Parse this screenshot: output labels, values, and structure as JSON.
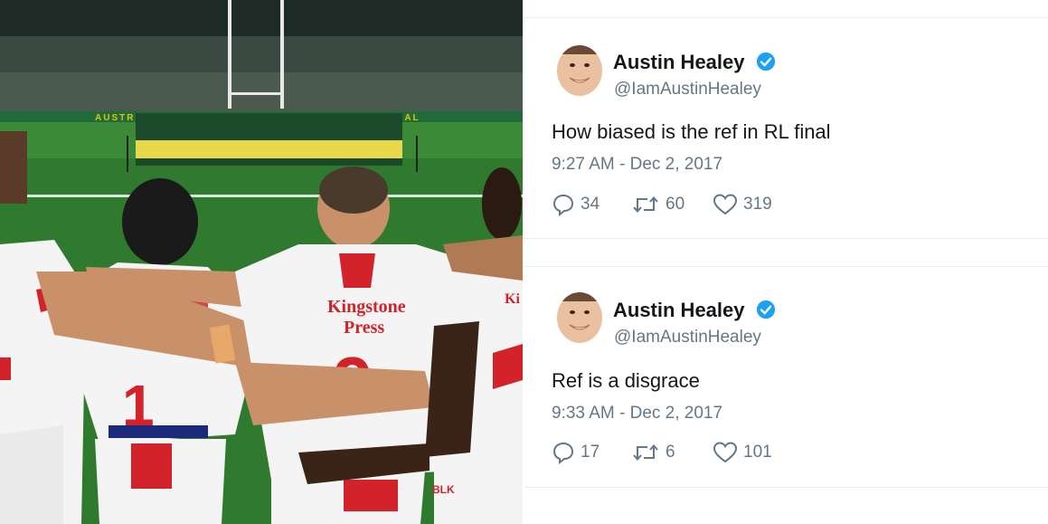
{
  "photo": {
    "stadium_banner": "AUSTRALIA",
    "jersey_sponsor_line1": "Kingstone",
    "jersey_sponsor_line2": "Press",
    "jersey_number_center": "9",
    "jersey_number_left": "1",
    "jersey_fragment": "tone",
    "jersey_fragment_right": "Ki",
    "jersey_brand": "BLK",
    "colors": {
      "jersey": "#f4f4f4",
      "red": "#d2232a",
      "pitch": "#2f7a2f",
      "aus_kit": "#1a4a2a"
    }
  },
  "tweets": [
    {
      "name": "Austin Healey",
      "handle": "@IamAustinHealey",
      "text": "How biased is the ref in RL final",
      "timestamp": "9:27 AM - Dec 2, 2017",
      "replies": "34",
      "retweets": "60",
      "likes": "319"
    },
    {
      "name": "Austin Healey",
      "handle": "@IamAustinHealey",
      "text": "Ref is a disgrace",
      "timestamp": "9:33 AM - Dec 2, 2017",
      "replies": "17",
      "retweets": "6",
      "likes": "101"
    }
  ],
  "icons": {
    "verified": "verified-badge-icon",
    "reply": "reply-icon",
    "retweet": "retweet-icon",
    "like": "heart-icon"
  },
  "colors": {
    "verified": "#1da1f2",
    "muted": "#657786",
    "text": "#14171a"
  }
}
